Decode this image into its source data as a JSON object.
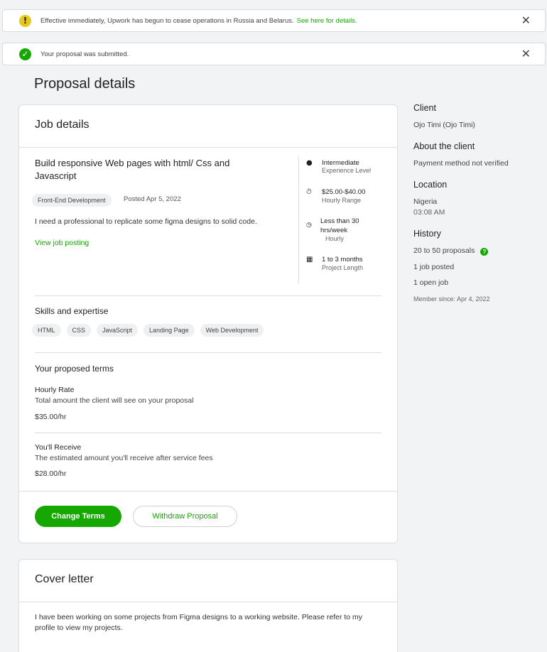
{
  "banners": [
    {
      "text": "Effective immediately, Upwork has begun to cease operations in Russia and Belarus.",
      "link": "See here for details.",
      "icon": "warning-icon",
      "color": "#e6c81a"
    },
    {
      "text": "Your proposal was submitted.",
      "icon": "check-circle-icon",
      "color": "#14a800"
    }
  ],
  "close_glyph": "✕",
  "page_title": "Proposal details",
  "job_details": {
    "card_title": "Job details",
    "title": "Build responsive Web pages with html/ Css and Javascript",
    "category": "Front-End Development",
    "posted": "Posted Apr 5, 2022",
    "description": "I need a professional to replicate some figma designs to solid code.",
    "view_link": "View job posting",
    "sidebar": [
      {
        "icon": "brain-icon",
        "primary": "Intermediate",
        "secondary": "Experience Level"
      },
      {
        "icon": "stopwatch-icon",
        "primary": "$25.00-$40.00",
        "secondary": "Hourly Range"
      },
      {
        "icon": "clock-icon",
        "primary": "Less than 30",
        "primary2": "hrs/week",
        "secondary": "Hourly"
      },
      {
        "icon": "calendar-icon",
        "primary": "1 to 3 months",
        "secondary": "Project Length"
      }
    ],
    "skills_heading": "Skills and expertise",
    "skills": [
      "HTML",
      "CSS",
      "JavaScript",
      "Landing Page",
      "Web Development"
    ],
    "terms_heading": "Your proposed terms",
    "hourly_rate": {
      "label": "Hourly Rate",
      "sub": "Total amount the client will see on your proposal",
      "value": "$35.00/hr"
    },
    "receive": {
      "label": "You'll Receive",
      "sub": "The estimated amount you'll receive after service fees",
      "value": "$28.00/hr"
    },
    "buttons": {
      "change": "Change Terms",
      "withdraw": "Withdraw Proposal"
    }
  },
  "cover_letter": {
    "card_title": "Cover letter",
    "text": "I have been working on some projects from Figma designs to a working website. Please refer to my profile to view my projects."
  },
  "client": {
    "heading": "Client",
    "name": "Ojo Timi (Ojo Timi)",
    "about_heading": "About the client",
    "payment": "Payment method not verified",
    "location_heading": "Location",
    "country": "Nigeria",
    "time": "03:08 AM",
    "history_heading": "History",
    "proposals": "20 to 50 proposals",
    "jobs_posted": "1 job posted",
    "open_job": "1 open job",
    "member_since": "Member since: Apr 4, 2022"
  }
}
